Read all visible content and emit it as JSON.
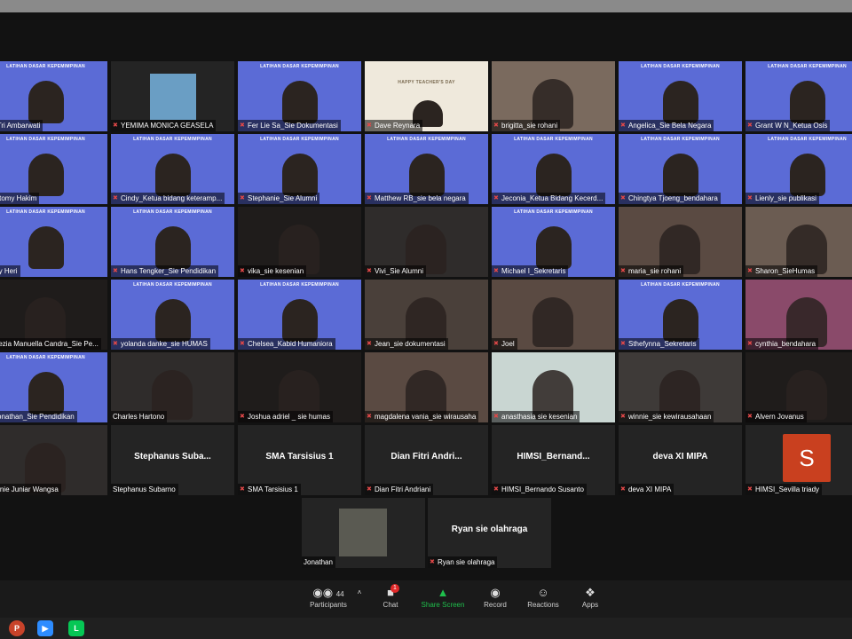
{
  "banner_text": "LATIHAN DASAR KEPEMIMPINAN",
  "teachers_day": "HAPPY TEACHER'S DAY",
  "tiles": [
    {
      "name": "dia Tri Ambarwati",
      "kind": "cam-banner",
      "active": true
    },
    {
      "name": "YEMIMA MONICA GEASELA",
      "kind": "photo",
      "muted": true
    },
    {
      "name": "Fer Lie Sa_Sie Dokumentasi",
      "kind": "cam-banner",
      "muted": true
    },
    {
      "name": "Dave Reynara",
      "kind": "teacher",
      "muted": true
    },
    {
      "name": "brigitta_sie rohani",
      "kind": "cam",
      "muted": true
    },
    {
      "name": "Angelica_Sie Bela Negara",
      "kind": "cam-banner",
      "muted": true
    },
    {
      "name": "Grant W N_Ketua Osis",
      "kind": "cam-banner",
      "muted": true
    },
    {
      "name": "thustomy Hakim",
      "kind": "cam-banner"
    },
    {
      "name": "Cindy_Ketua bidang keteramp...",
      "kind": "cam-banner",
      "muted": true
    },
    {
      "name": "Stephanie_Sie Alumni",
      "kind": "cam-banner",
      "muted": true
    },
    {
      "name": "Matthew RB_sie bela negara",
      "kind": "cam-banner",
      "muted": true
    },
    {
      "name": "Jeconia_Ketua Bidang Kecerd...",
      "kind": "cam-banner",
      "muted": true
    },
    {
      "name": "Chingtya Tjoeng_bendahara",
      "kind": "cam-banner",
      "muted": true
    },
    {
      "name": "Lienly_sie publikasi",
      "kind": "cam-banner",
      "muted": true
    },
    {
      "name": "Deny Heri",
      "kind": "cam-banner"
    },
    {
      "name": "Hans Tengker_Sie Pendidikan",
      "kind": "cam-banner",
      "muted": true
    },
    {
      "name": "vika_sie kesenian",
      "kind": "cam-dark",
      "muted": true
    },
    {
      "name": "Vivi_Sie Alumni",
      "kind": "cam",
      "muted": true
    },
    {
      "name": "Michael I_Sekretaris",
      "kind": "cam-banner",
      "muted": true
    },
    {
      "name": "maria_sie rohani",
      "kind": "cam",
      "muted": true
    },
    {
      "name": "Sharon_SieHumas",
      "kind": "cam",
      "muted": true
    },
    {
      "name": "Kezia Manuella Candra_Sie Pe...",
      "kind": "cam-dark",
      "muted": true
    },
    {
      "name": "yolanda danke_sie HUMAS",
      "kind": "cam-banner",
      "muted": true
    },
    {
      "name": "Chelsea_Kabid Humaniora",
      "kind": "cam-banner",
      "muted": true
    },
    {
      "name": "Jean_sie dokumentasi",
      "kind": "cam",
      "muted": true
    },
    {
      "name": "Joel",
      "kind": "cam",
      "muted": true
    },
    {
      "name": "Sthefynna_Sekretaris",
      "kind": "cam-banner",
      "muted": true
    },
    {
      "name": "cynthia_bendahara",
      "kind": "cam-room",
      "muted": true
    },
    {
      "name": "Jonathan_Sie Pendidikan",
      "kind": "cam-banner",
      "muted": true
    },
    {
      "name": "Charles Hartono",
      "kind": "cam"
    },
    {
      "name": "Joshua adriel _ sie humas",
      "kind": "cam-dark",
      "muted": true
    },
    {
      "name": "magdalena vania_sie wirausaha",
      "kind": "cam",
      "muted": true
    },
    {
      "name": "anasthasia sie kesenian",
      "kind": "cam-light",
      "muted": true
    },
    {
      "name": "winnie_sie kewirausahaan",
      "kind": "cam",
      "muted": true
    },
    {
      "name": "Alvern Jovanus",
      "kind": "cam-dark",
      "muted": true
    },
    {
      "name": "Weynie Juniar Wangsa",
      "kind": "cam"
    },
    {
      "name": "Stephanus Subarno",
      "kind": "text",
      "display": "Stephanus  Suba..."
    },
    {
      "name": "SMA Tarsisius 1",
      "kind": "text",
      "display": "SMA Tarsisius 1",
      "muted": true
    },
    {
      "name": "Dian Fitri Andriani",
      "kind": "text",
      "display": "Dian  Fitri  Andri...",
      "muted": true
    },
    {
      "name": "HIMSI_Bernando Susanto",
      "kind": "text",
      "display": "HIMSI_Bernand...",
      "muted": true
    },
    {
      "name": "deva XI MIPA",
      "kind": "text",
      "display": "deva XI MIPA",
      "muted": true
    },
    {
      "name": "HIMSI_Sevilla triady",
      "kind": "avatar",
      "letter": "S",
      "muted": true
    },
    {
      "name": "Jonathan",
      "kind": "photo-ape"
    },
    {
      "name": "Ryan sie olahraga",
      "kind": "text",
      "display": "Ryan sie olahraga",
      "muted": true
    }
  ],
  "controls": [
    {
      "label": "Participants",
      "count": "44"
    },
    {
      "label": "Chat",
      "badge": "1"
    },
    {
      "label": "Share Screen"
    },
    {
      "label": "Record"
    },
    {
      "label": "Reactions"
    },
    {
      "label": "Apps"
    }
  ],
  "taskbar": [
    "powerpoint-icon",
    "zoom-icon",
    "line-icon"
  ],
  "colors": {
    "banner": "#5b6bd6",
    "share": "#1fbf4c",
    "avatar": "#c9401f"
  }
}
